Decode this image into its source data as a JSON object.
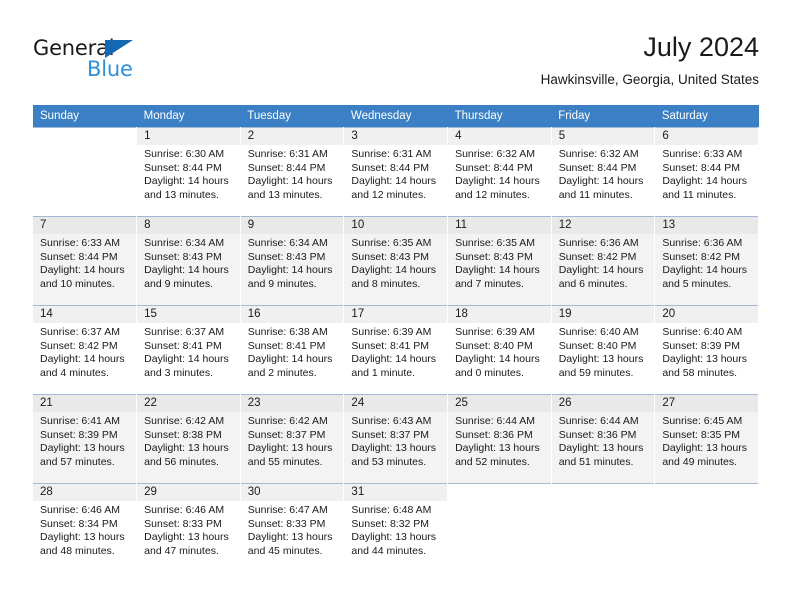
{
  "logo": {
    "primary_text": "General",
    "secondary_text": "Blue",
    "triangle_color": "#1268b3",
    "secondary_color": "#2f8fd8"
  },
  "header": {
    "title": "July 2024",
    "subtitle": "Hawkinsville, Georgia, United States"
  },
  "theme": {
    "header_bg": "#3b7fc4",
    "header_text": "#ffffff",
    "row_shade": "#f3f3f3",
    "daynum_bg": "#f0f0f0",
    "grid_line": "#9fb9d6"
  },
  "calendar": {
    "weekdays": [
      "Sunday",
      "Monday",
      "Tuesday",
      "Wednesday",
      "Thursday",
      "Friday",
      "Saturday"
    ],
    "labels": {
      "sunrise": "Sunrise:",
      "sunset": "Sunset:",
      "daylight": "Daylight:"
    },
    "weeks": [
      {
        "shaded": false,
        "days": [
          {
            "day": "",
            "sunrise": "",
            "sunset": "",
            "daylight": "",
            "empty": true
          },
          {
            "day": "1",
            "sunrise": "Sunrise: 6:30 AM",
            "sunset": "Sunset: 8:44 PM",
            "daylight": "Daylight: 14 hours and 13 minutes.",
            "empty": false
          },
          {
            "day": "2",
            "sunrise": "Sunrise: 6:31 AM",
            "sunset": "Sunset: 8:44 PM",
            "daylight": "Daylight: 14 hours and 13 minutes.",
            "empty": false
          },
          {
            "day": "3",
            "sunrise": "Sunrise: 6:31 AM",
            "sunset": "Sunset: 8:44 PM",
            "daylight": "Daylight: 14 hours and 12 minutes.",
            "empty": false
          },
          {
            "day": "4",
            "sunrise": "Sunrise: 6:32 AM",
            "sunset": "Sunset: 8:44 PM",
            "daylight": "Daylight: 14 hours and 12 minutes.",
            "empty": false
          },
          {
            "day": "5",
            "sunrise": "Sunrise: 6:32 AM",
            "sunset": "Sunset: 8:44 PM",
            "daylight": "Daylight: 14 hours and 11 minutes.",
            "empty": false
          },
          {
            "day": "6",
            "sunrise": "Sunrise: 6:33 AM",
            "sunset": "Sunset: 8:44 PM",
            "daylight": "Daylight: 14 hours and 11 minutes.",
            "empty": false
          }
        ]
      },
      {
        "shaded": true,
        "days": [
          {
            "day": "7",
            "sunrise": "Sunrise: 6:33 AM",
            "sunset": "Sunset: 8:44 PM",
            "daylight": "Daylight: 14 hours and 10 minutes.",
            "empty": false
          },
          {
            "day": "8",
            "sunrise": "Sunrise: 6:34 AM",
            "sunset": "Sunset: 8:43 PM",
            "daylight": "Daylight: 14 hours and 9 minutes.",
            "empty": false
          },
          {
            "day": "9",
            "sunrise": "Sunrise: 6:34 AM",
            "sunset": "Sunset: 8:43 PM",
            "daylight": "Daylight: 14 hours and 9 minutes.",
            "empty": false
          },
          {
            "day": "10",
            "sunrise": "Sunrise: 6:35 AM",
            "sunset": "Sunset: 8:43 PM",
            "daylight": "Daylight: 14 hours and 8 minutes.",
            "empty": false
          },
          {
            "day": "11",
            "sunrise": "Sunrise: 6:35 AM",
            "sunset": "Sunset: 8:43 PM",
            "daylight": "Daylight: 14 hours and 7 minutes.",
            "empty": false
          },
          {
            "day": "12",
            "sunrise": "Sunrise: 6:36 AM",
            "sunset": "Sunset: 8:42 PM",
            "daylight": "Daylight: 14 hours and 6 minutes.",
            "empty": false
          },
          {
            "day": "13",
            "sunrise": "Sunrise: 6:36 AM",
            "sunset": "Sunset: 8:42 PM",
            "daylight": "Daylight: 14 hours and 5 minutes.",
            "empty": false
          }
        ]
      },
      {
        "shaded": false,
        "days": [
          {
            "day": "14",
            "sunrise": "Sunrise: 6:37 AM",
            "sunset": "Sunset: 8:42 PM",
            "daylight": "Daylight: 14 hours and 4 minutes.",
            "empty": false
          },
          {
            "day": "15",
            "sunrise": "Sunrise: 6:37 AM",
            "sunset": "Sunset: 8:41 PM",
            "daylight": "Daylight: 14 hours and 3 minutes.",
            "empty": false
          },
          {
            "day": "16",
            "sunrise": "Sunrise: 6:38 AM",
            "sunset": "Sunset: 8:41 PM",
            "daylight": "Daylight: 14 hours and 2 minutes.",
            "empty": false
          },
          {
            "day": "17",
            "sunrise": "Sunrise: 6:39 AM",
            "sunset": "Sunset: 8:41 PM",
            "daylight": "Daylight: 14 hours and 1 minute.",
            "empty": false
          },
          {
            "day": "18",
            "sunrise": "Sunrise: 6:39 AM",
            "sunset": "Sunset: 8:40 PM",
            "daylight": "Daylight: 14 hours and 0 minutes.",
            "empty": false
          },
          {
            "day": "19",
            "sunrise": "Sunrise: 6:40 AM",
            "sunset": "Sunset: 8:40 PM",
            "daylight": "Daylight: 13 hours and 59 minutes.",
            "empty": false
          },
          {
            "day": "20",
            "sunrise": "Sunrise: 6:40 AM",
            "sunset": "Sunset: 8:39 PM",
            "daylight": "Daylight: 13 hours and 58 minutes.",
            "empty": false
          }
        ]
      },
      {
        "shaded": true,
        "days": [
          {
            "day": "21",
            "sunrise": "Sunrise: 6:41 AM",
            "sunset": "Sunset: 8:39 PM",
            "daylight": "Daylight: 13 hours and 57 minutes.",
            "empty": false
          },
          {
            "day": "22",
            "sunrise": "Sunrise: 6:42 AM",
            "sunset": "Sunset: 8:38 PM",
            "daylight": "Daylight: 13 hours and 56 minutes.",
            "empty": false
          },
          {
            "day": "23",
            "sunrise": "Sunrise: 6:42 AM",
            "sunset": "Sunset: 8:37 PM",
            "daylight": "Daylight: 13 hours and 55 minutes.",
            "empty": false
          },
          {
            "day": "24",
            "sunrise": "Sunrise: 6:43 AM",
            "sunset": "Sunset: 8:37 PM",
            "daylight": "Daylight: 13 hours and 53 minutes.",
            "empty": false
          },
          {
            "day": "25",
            "sunrise": "Sunrise: 6:44 AM",
            "sunset": "Sunset: 8:36 PM",
            "daylight": "Daylight: 13 hours and 52 minutes.",
            "empty": false
          },
          {
            "day": "26",
            "sunrise": "Sunrise: 6:44 AM",
            "sunset": "Sunset: 8:36 PM",
            "daylight": "Daylight: 13 hours and 51 minutes.",
            "empty": false
          },
          {
            "day": "27",
            "sunrise": "Sunrise: 6:45 AM",
            "sunset": "Sunset: 8:35 PM",
            "daylight": "Daylight: 13 hours and 49 minutes.",
            "empty": false
          }
        ]
      },
      {
        "shaded": false,
        "days": [
          {
            "day": "28",
            "sunrise": "Sunrise: 6:46 AM",
            "sunset": "Sunset: 8:34 PM",
            "daylight": "Daylight: 13 hours and 48 minutes.",
            "empty": false
          },
          {
            "day": "29",
            "sunrise": "Sunrise: 6:46 AM",
            "sunset": "Sunset: 8:33 PM",
            "daylight": "Daylight: 13 hours and 47 minutes.",
            "empty": false
          },
          {
            "day": "30",
            "sunrise": "Sunrise: 6:47 AM",
            "sunset": "Sunset: 8:33 PM",
            "daylight": "Daylight: 13 hours and 45 minutes.",
            "empty": false
          },
          {
            "day": "31",
            "sunrise": "Sunrise: 6:48 AM",
            "sunset": "Sunset: 8:32 PM",
            "daylight": "Daylight: 13 hours and 44 minutes.",
            "empty": false
          },
          {
            "day": "",
            "sunrise": "",
            "sunset": "",
            "daylight": "",
            "empty": true
          },
          {
            "day": "",
            "sunrise": "",
            "sunset": "",
            "daylight": "",
            "empty": true
          },
          {
            "day": "",
            "sunrise": "",
            "sunset": "",
            "daylight": "",
            "empty": true
          }
        ]
      }
    ]
  }
}
